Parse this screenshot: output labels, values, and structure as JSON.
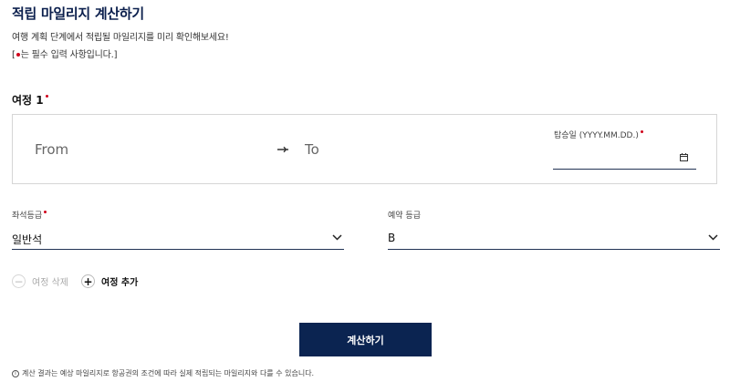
{
  "page": {
    "title": "적립 마일리지 계산하기",
    "subtitle": "여행 계획 단계에서 적립될 마일리지를 미리 확인해보세요!",
    "required_note_prefix": "[",
    "required_note_suffix": "는 필수 입력 사항입니다.]"
  },
  "journey": {
    "title": "여정 1",
    "from_placeholder": "From",
    "to_placeholder": "To",
    "date_label": "탑승일 (YYYY.MM.DD.)",
    "date_value": ""
  },
  "seat_class": {
    "label": "좌석등급",
    "value": "일반석"
  },
  "booking_class": {
    "label": "예약 등급",
    "value": "B"
  },
  "actions": {
    "remove_label": "여정 삭제",
    "add_label": "여정 추가",
    "calculate_label": "계산하기"
  },
  "footnote": "계산 결과는 예상 마일리지로 항공권의 조건에 따라 실제 적립되는 마일리지와 다를 수 있습니다.",
  "colors": {
    "primary": "#0b2451",
    "required": "#d0021b",
    "border": "#d6d6d6"
  }
}
